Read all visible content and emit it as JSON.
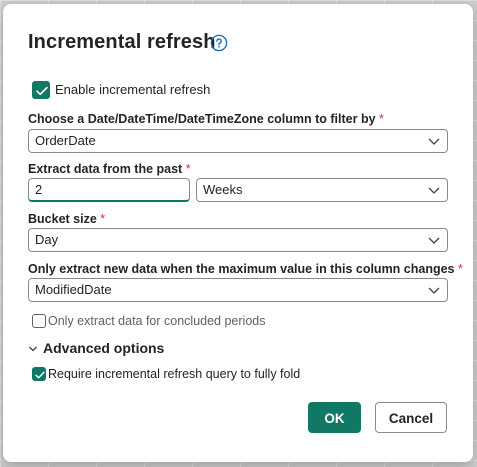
{
  "dialog": {
    "title": "Incremental refresh",
    "help_icon": "help-circle-icon"
  },
  "enable_incremental": {
    "label": "Enable incremental refresh",
    "checked": true
  },
  "date_column": {
    "label": "Choose a Date/DateTime/DateTimeZone column to filter by",
    "required_mark": "*",
    "value": "OrderDate"
  },
  "extract_past": {
    "label": "Extract data from the past",
    "required_mark": "*",
    "amount": "2",
    "unit": "Weeks"
  },
  "bucket_size": {
    "label": "Bucket size",
    "required_mark": "*",
    "value": "Day"
  },
  "change_column": {
    "label": "Only extract new data when the maximum value in this column changes",
    "required_mark": "*",
    "value": "ModifiedDate"
  },
  "concluded_periods": {
    "label": "Only extract data for concluded periods",
    "checked": false
  },
  "advanced": {
    "label": "Advanced options",
    "expanded": true
  },
  "require_fold": {
    "label": "Require incremental refresh query to fully fold",
    "checked": true
  },
  "buttons": {
    "ok": "OK",
    "cancel": "Cancel"
  },
  "colors": {
    "accent": "#117865",
    "required": "#c4314b",
    "help": "#0f6cbd"
  }
}
